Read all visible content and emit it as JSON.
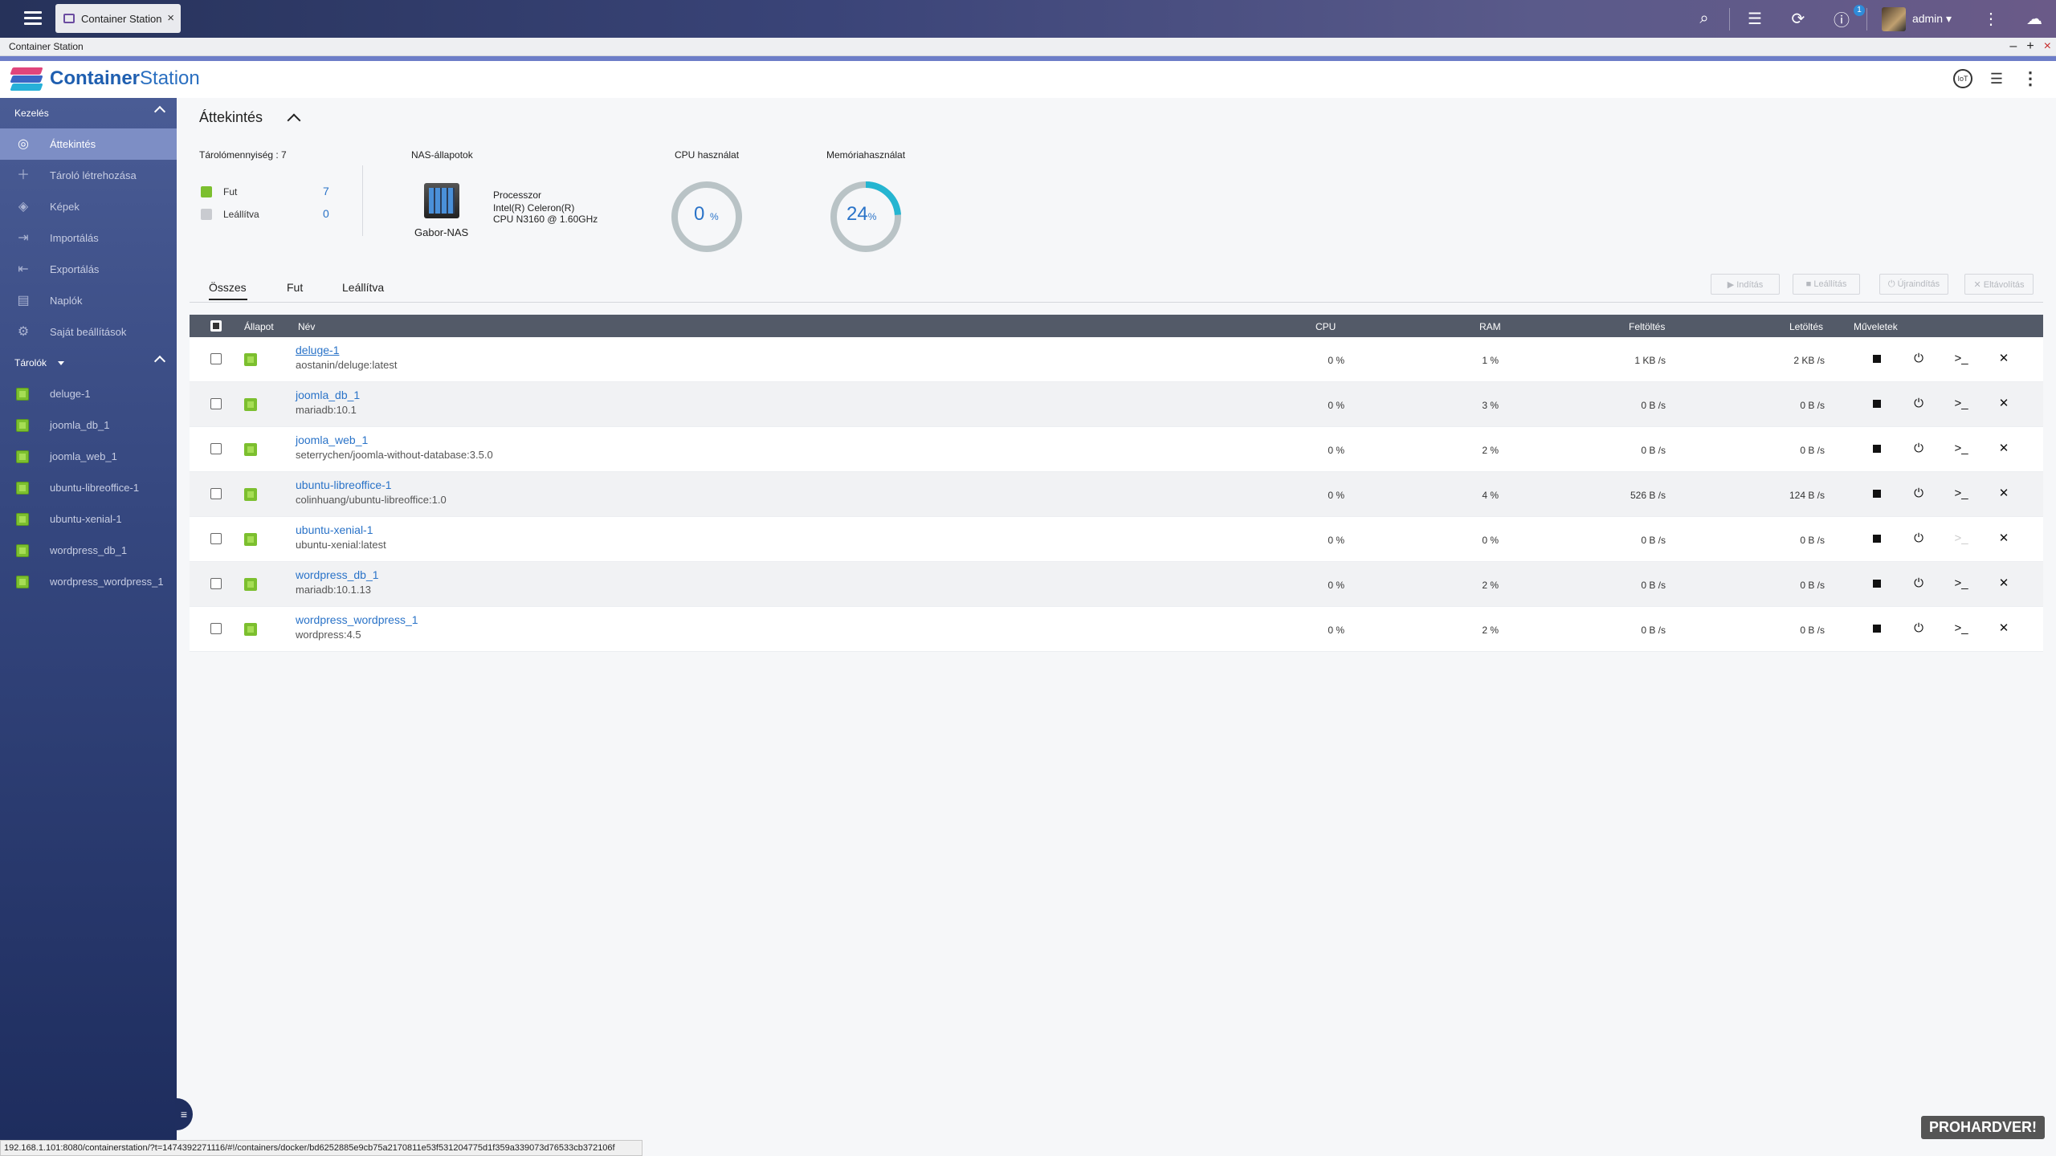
{
  "os": {
    "tab_title": "Container Station",
    "user": "admin",
    "notif_count": "1"
  },
  "window": {
    "title": "Container Station",
    "controls": [
      "–",
      "+",
      "×"
    ]
  },
  "app": {
    "brand_bold": "Container",
    "brand_light": "Station",
    "header_badge": "IoT"
  },
  "sidebar": {
    "section_manage": "Kezelés",
    "items": [
      {
        "label": "Áttekintés",
        "icon": "overview-icon",
        "active": true
      },
      {
        "label": "Tároló létrehozása",
        "icon": "plus-icon"
      },
      {
        "label": "Képek",
        "icon": "layers-icon"
      },
      {
        "label": "Importálás",
        "icon": "import-icon"
      },
      {
        "label": "Exportálás",
        "icon": "export-icon"
      },
      {
        "label": "Naplók",
        "icon": "log-icon"
      },
      {
        "label": "Saját beállítások",
        "icon": "gear-icon"
      }
    ],
    "section_containers": "Tárolók",
    "containers": [
      "deluge-1",
      "joomla_db_1",
      "joomla_web_1",
      "ubuntu-libreoffice-1",
      "ubuntu-xenial-1",
      "wordpress_db_1",
      "wordpress_wordpress_1"
    ]
  },
  "overview": {
    "title": "Áttekintés",
    "capacity_label": "Tárolómennyiség : 7",
    "running_label": "Fut",
    "running_count": "7",
    "stopped_label": "Leállítva",
    "stopped_count": "0",
    "nas_label": "NAS-állapotok",
    "nas_name": "Gabor-NAS",
    "proc_label": "Processzor",
    "proc_line1": "Intel(R) Celeron(R)",
    "proc_line2": "CPU N3160 @ 1.60GHz",
    "cpu_label": "CPU használat",
    "cpu_value": 0,
    "mem_label": "Memóriahasználat",
    "mem_value": 24,
    "percent": "%"
  },
  "tabs": [
    "Összes",
    "Fut",
    "Leállítva"
  ],
  "actions": [
    "▶ Indítás",
    "■ Leállítás",
    "⏻ Újraindítás",
    "✕ Eltávolítás"
  ],
  "table": {
    "headers": {
      "status": "Állapot",
      "name": "Név",
      "cpu": "CPU",
      "ram": "RAM",
      "up": "Feltöltés",
      "down": "Letöltés",
      "ops": "Műveletek"
    },
    "rows": [
      {
        "name": "deluge-1",
        "image": "aostanin/deluge:latest",
        "cpu": "0 %",
        "ram": "1 %",
        "up": "1 KB /s",
        "down": "2 KB /s",
        "terminal_enabled": true
      },
      {
        "name": "joomla_db_1",
        "image": "mariadb:10.1",
        "cpu": "0 %",
        "ram": "3 %",
        "up": "0 B /s",
        "down": "0 B /s",
        "terminal_enabled": true
      },
      {
        "name": "joomla_web_1",
        "image": "seterrychen/joomla-without-database:3.5.0",
        "cpu": "0 %",
        "ram": "2 %",
        "up": "0 B /s",
        "down": "0 B /s",
        "terminal_enabled": true
      },
      {
        "name": "ubuntu-libreoffice-1",
        "image": "colinhuang/ubuntu-libreoffice:1.0",
        "cpu": "0 %",
        "ram": "4 %",
        "up": "526 B /s",
        "down": "124 B /s",
        "terminal_enabled": true
      },
      {
        "name": "ubuntu-xenial-1",
        "image": "ubuntu-xenial:latest",
        "cpu": "0 %",
        "ram": "0 %",
        "up": "0 B /s",
        "down": "0 B /s",
        "terminal_enabled": false
      },
      {
        "name": "wordpress_db_1",
        "image": "mariadb:10.1.13",
        "cpu": "0 %",
        "ram": "2 %",
        "up": "0 B /s",
        "down": "0 B /s",
        "terminal_enabled": true
      },
      {
        "name": "wordpress_wordpress_1",
        "image": "wordpress:4.5",
        "cpu": "0 %",
        "ram": "2 %",
        "up": "0 B /s",
        "down": "0 B /s",
        "terminal_enabled": true
      }
    ]
  },
  "status_url": "192.168.1.101:8080/containerstation/?t=1474392271116/#!/containers/docker/bd6252885e9cb75a2170811e53f531204775d1f359a339073d76533cb372106f",
  "watermark": "PROHARDVER!",
  "colors": {
    "accent": "#2a73c8",
    "running": "#7cbf2f",
    "gauge_track": "#b9c3c6",
    "gauge_fill": "#25b5d1"
  }
}
